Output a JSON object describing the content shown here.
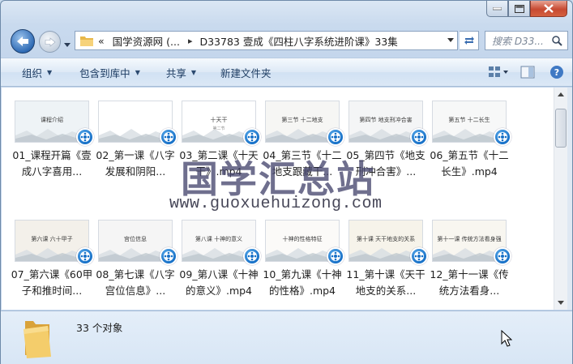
{
  "window": {
    "minimize_icon": "minimize-icon",
    "maximize_icon": "maximize-icon",
    "close_icon": "close-icon"
  },
  "address": {
    "overflow": "«",
    "root": "国学资源网 (...",
    "current": "D33783 壹成《四柱八字系统进阶课》33集"
  },
  "search": {
    "placeholder": "搜索 D33..."
  },
  "toolbar": {
    "organize": "组织",
    "include_library": "包含到库中",
    "share": "共享",
    "new_folder": "新建文件夹"
  },
  "files": [
    {
      "label": "01_课程开篇《壹成八字喜用...",
      "thumb_title": "课程介绍",
      "thumb_sub": ""
    },
    {
      "label": "02_第一课《八字发展和阴阳...",
      "thumb_title": "",
      "thumb_sub": ""
    },
    {
      "label": "03_第二课《十天干》.mp4",
      "thumb_title": "十天干",
      "thumb_sub": "第二节"
    },
    {
      "label": "04_第三节《十二地支跟藏干...",
      "thumb_title": "第三节 十二地支",
      "thumb_sub": ""
    },
    {
      "label": "05_第四节《地支刑冲合害》...",
      "thumb_title": "第四节 地支刑冲合害",
      "thumb_sub": ""
    },
    {
      "label": "06_第五节《十二长生》.mp4",
      "thumb_title": "第五节 十二长生",
      "thumb_sub": ""
    },
    {
      "label": "07_第六课《60甲子和推时间...",
      "thumb_title": "第六课 六十甲子",
      "thumb_sub": ""
    },
    {
      "label": "08_第七课《八字宫位信息》...",
      "thumb_title": "宫位信息",
      "thumb_sub": ""
    },
    {
      "label": "09_第八课《十神的意义》.mp4",
      "thumb_title": "第八课 十神的意义",
      "thumb_sub": ""
    },
    {
      "label": "10_第九课《十神的性格》.mp4",
      "thumb_title": "十神的性格特征",
      "thumb_sub": ""
    },
    {
      "label": "11_第十课《天干地支的关系...",
      "thumb_title": "第十课 天干地支的关系",
      "thumb_sub": ""
    },
    {
      "label": "12_第十一课《传统方法看身...",
      "thumb_title": "第十一课 传统方法看身强",
      "thumb_sub": ""
    }
  ],
  "watermark": {
    "chinese": "国学汇总站",
    "url": "www.guoxuehuizong.com"
  },
  "details": {
    "count": "33 个对象"
  },
  "colors": {
    "accent": "#1e3d63",
    "badge": "#1770c7"
  }
}
